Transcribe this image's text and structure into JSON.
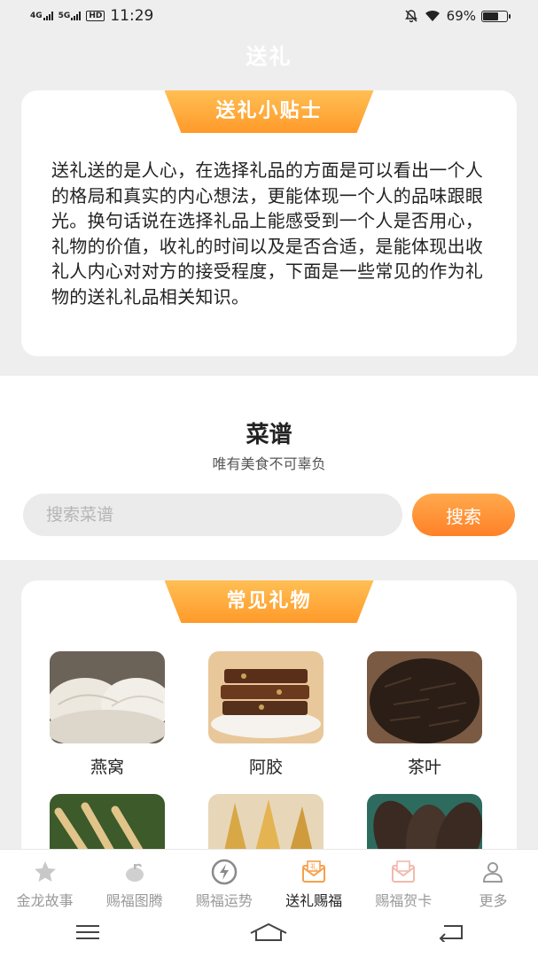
{
  "status_bar": {
    "net1": "4G",
    "net2": "5G",
    "hd": "HD",
    "time": "11:29",
    "battery": "69%",
    "battery_level": 0.69
  },
  "header": {
    "title": "送礼"
  },
  "tips": {
    "title": "送礼小贴士",
    "text": "送礼送的是人心，在选择礼品的方面是可以看出一个人的格局和真实的内心想法，更能体现一个人的品味跟眼光。换句话说在选择礼品上能感受到一个人是否用心，礼物的价值，收礼的时间以及是否合适，是能体现出收礼人内心对对方的接受程度，下面是一些常见的作为礼物的送礼礼品相关知识。"
  },
  "recipe": {
    "title": "菜谱",
    "subtitle": "唯有美食不可辜负",
    "search_placeholder": "搜索菜谱",
    "search_button": "搜索"
  },
  "gifts": {
    "title": "常见礼物",
    "items": [
      {
        "name": "燕窝",
        "icon": "birds-nest-image"
      },
      {
        "name": "阿胶",
        "icon": "ejiao-image"
      },
      {
        "name": "茶叶",
        "icon": "tea-image"
      },
      {
        "name": "",
        "icon": "ginseng-image"
      },
      {
        "name": "",
        "icon": "fish-maw-image"
      },
      {
        "name": "",
        "icon": "sea-cucumber-image"
      }
    ]
  },
  "tabs": [
    {
      "label": "金龙故事",
      "icon": "star-icon",
      "active": false
    },
    {
      "label": "赐福图腾",
      "icon": "pumpkin-icon",
      "active": false
    },
    {
      "label": "赐福运势",
      "icon": "lightning-icon",
      "active": false
    },
    {
      "label": "送礼赐福",
      "icon": "envelope-icon",
      "active": true
    },
    {
      "label": "赐福贺卡",
      "icon": "card-envelope-icon",
      "active": false
    },
    {
      "label": "更多",
      "icon": "user-icon",
      "active": false
    }
  ],
  "colors": {
    "accent": "#ff9a2a",
    "active_icon": "#f7a04a",
    "inactive": "#9a9a9a"
  }
}
